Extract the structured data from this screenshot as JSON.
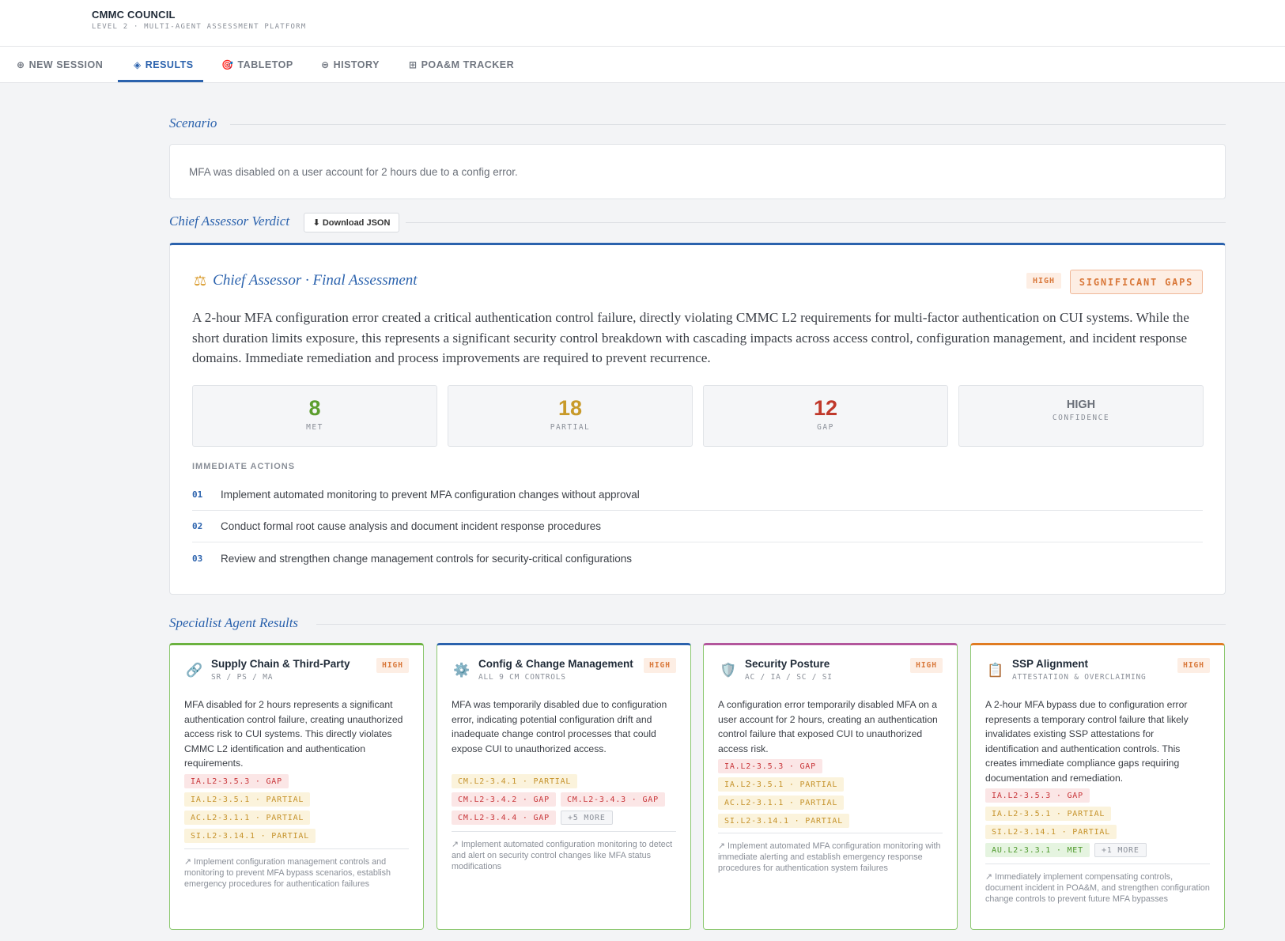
{
  "brand": {
    "title": "CMMC COUNCIL",
    "subtitle": "LEVEL 2 · MULTI-AGENT ASSESSMENT PLATFORM"
  },
  "tabs": [
    {
      "icon": "⊕",
      "label": "NEW SESSION"
    },
    {
      "icon": "◈",
      "label": "RESULTS",
      "active": true
    },
    {
      "icon": "🎯",
      "label": "TABLETOP"
    },
    {
      "icon": "⊜",
      "label": "HISTORY"
    },
    {
      "icon": "⊞",
      "label": "POA&M TRACKER"
    }
  ],
  "scenario": {
    "heading": "Scenario",
    "text": "MFA was disabled on a user account for 2 hours due to a config error."
  },
  "verdict": {
    "heading": "Chief Assessor Verdict",
    "download_label": "⬇ Download JSON",
    "title": "Chief Assessor · Final Assessment",
    "title_icon": "⚖",
    "confidence_badge": "HIGH",
    "status_badge": "SIGNIFICANT GAPS",
    "summary": "A 2-hour MFA configuration error created a critical authentication control failure, directly violating CMMC L2 requirements for multi-factor authentication on CUI systems. While the short duration limits exposure, this represents a significant security control breakdown with cascading impacts across access control, configuration management, and incident response domains. Immediate remediation and process improvements are required to prevent recurrence.",
    "stats": {
      "met": {
        "value": "8",
        "label": "MET",
        "color": "#5c9e2e"
      },
      "partial": {
        "value": "18",
        "label": "PARTIAL",
        "color": "#c89a2a"
      },
      "gap": {
        "value": "12",
        "label": "GAP",
        "color": "#c0392b"
      },
      "confidence": {
        "value": "HIGH",
        "label": "CONFIDENCE"
      }
    },
    "actions_label": "IMMEDIATE ACTIONS",
    "actions": [
      {
        "num": "01",
        "text": "Implement automated monitoring to prevent MFA configuration changes without approval"
      },
      {
        "num": "02",
        "text": "Conduct formal root cause analysis and document incident response procedures"
      },
      {
        "num": "03",
        "text": "Review and strengthen change management controls for security-critical configurations"
      }
    ]
  },
  "specialists": {
    "heading": "Specialist Agent Results",
    "agents": [
      {
        "icon": "🔗",
        "name": "Supply Chain & Third-Party",
        "sub": "SR / PS / MA",
        "badge": "HIGH",
        "body": "MFA disabled for 2 hours represents a significant authentication control failure, creating unauthorized access risk to CUI systems. This directly violates CMMC L2 identification and authentication requirements.",
        "tags": [
          {
            "text": "IA.L2-3.5.3 · GAP",
            "kind": "gap"
          },
          {
            "text": "IA.L2-3.5.1 · PARTIAL",
            "kind": "partial"
          },
          {
            "text": "AC.L2-3.1.1 · PARTIAL",
            "kind": "partial"
          },
          {
            "text": "SI.L2-3.14.1 · PARTIAL",
            "kind": "partial"
          }
        ],
        "rec": "↗ Implement configuration management controls and monitoring to prevent MFA bypass scenarios, establish emergency procedures for authentication failures"
      },
      {
        "icon": "⚙️",
        "name": "Config & Change Management",
        "sub": "ALL 9 CM CONTROLS",
        "badge": "HIGH",
        "body": "MFA was temporarily disabled due to configuration error, indicating potential configuration drift and inadequate change control processes that could expose CUI to unauthorized access.",
        "tags": [
          {
            "text": "CM.L2-3.4.1 · PARTIAL",
            "kind": "partial"
          },
          {
            "text": "CM.L2-3.4.2 · GAP",
            "kind": "gap"
          },
          {
            "text": "CM.L2-3.4.3 · GAP",
            "kind": "gap"
          },
          {
            "text": "CM.L2-3.4.4 · GAP",
            "kind": "gap"
          },
          {
            "text": "+5 MORE",
            "kind": "more"
          }
        ],
        "rec": "↗ Implement automated configuration monitoring to detect and alert on security control changes like MFA status modifications"
      },
      {
        "icon": "🛡️",
        "name": "Security Posture",
        "sub": "AC / IA / SC / SI",
        "badge": "HIGH",
        "body": "A configuration error temporarily disabled MFA on a user account for 2 hours, creating an authentication control failure that exposed CUI to unauthorized access risk.",
        "tags": [
          {
            "text": "IA.L2-3.5.3 · GAP",
            "kind": "gap"
          },
          {
            "text": "IA.L2-3.5.1 · PARTIAL",
            "kind": "partial"
          },
          {
            "text": "AC.L2-3.1.1 · PARTIAL",
            "kind": "partial"
          },
          {
            "text": "SI.L2-3.14.1 · PARTIAL",
            "kind": "partial"
          }
        ],
        "rec": "↗ Implement automated MFA configuration monitoring with immediate alerting and establish emergency response procedures for authentication system failures"
      },
      {
        "icon": "📋",
        "name": "SSP Alignment",
        "sub": "ATTESTATION & OVERCLAIMING",
        "badge": "HIGH",
        "body": "A 2-hour MFA bypass due to configuration error represents a temporary control failure that likely invalidates existing SSP attestations for identification and authentication controls. This creates immediate compliance gaps requiring documentation and remediation.",
        "tags": [
          {
            "text": "IA.L2-3.5.3 · GAP",
            "kind": "gap"
          },
          {
            "text": "IA.L2-3.5.1 · PARTIAL",
            "kind": "partial"
          },
          {
            "text": "SI.L2-3.14.1 · PARTIAL",
            "kind": "partial"
          },
          {
            "text": "AU.L2-3.3.1 · MET",
            "kind": "met"
          },
          {
            "text": "+1 MORE",
            "kind": "more"
          }
        ],
        "rec": "↗ Immediately implement compensating controls, document incident in POA&M, and strengthen configuration change controls to prevent future MFA bypasses"
      }
    ]
  }
}
